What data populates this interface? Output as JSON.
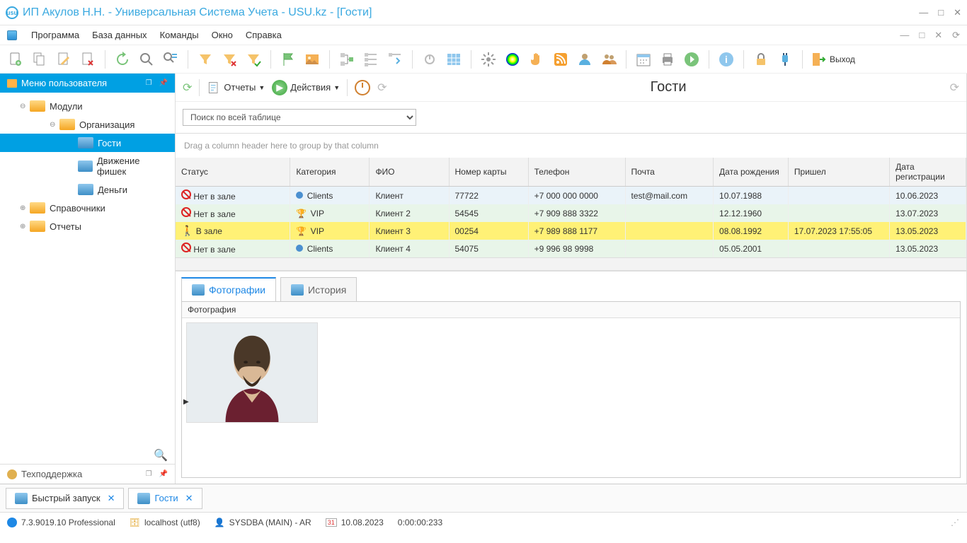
{
  "title": "ИП Акулов Н.Н. - Универсальная Система Учета - USU.kz - [Гости]",
  "menubar": {
    "items": [
      "Программа",
      "База данных",
      "Команды",
      "Окно",
      "Справка"
    ]
  },
  "toolbar": {
    "exit": "Выход"
  },
  "sidebar": {
    "title": "Меню пользователя",
    "modules": "Модули",
    "organization": "Организация",
    "guests": "Гости",
    "chips": "Движение фишек",
    "money": "Деньги",
    "refs": "Справочники",
    "reports": "Отчеты",
    "support": "Техподдержка"
  },
  "subtoolbar": {
    "reports": "Отчеты",
    "actions": "Действия",
    "title": "Гости"
  },
  "search": {
    "placeholder": "Поиск по всей таблице"
  },
  "grid": {
    "groupHint": "Drag a column header here to group by that column",
    "headers": [
      "Статус",
      "Категория",
      "ФИО",
      "Номер карты",
      "Телефон",
      "Почта",
      "Дата рождения",
      "Пришел",
      "Дата регистрации"
    ],
    "rows": [
      {
        "statusIcon": "out",
        "status": "Нет в зале",
        "catIcon": "client",
        "cat": "Clients",
        "fio": "Клиент",
        "card": "77722",
        "tel": "+7 000 000 0000",
        "mail": "test@mail.com",
        "dob": "10.07.1988",
        "came": "",
        "reg": "10.06.2023"
      },
      {
        "statusIcon": "out",
        "status": "Нет в зале",
        "catIcon": "vip",
        "cat": "VIP",
        "fio": "Клиент 2",
        "card": "54545",
        "tel": "+7 909 888 3322",
        "mail": "",
        "dob": "12.12.1960",
        "came": "",
        "reg": "13.07.2023"
      },
      {
        "statusIcon": "in",
        "status": "В зале",
        "catIcon": "vip",
        "cat": "VIP",
        "fio": "Клиент 3",
        "card": "00254",
        "tel": "+7 989 888 1177",
        "mail": "",
        "dob": "08.08.1992",
        "came": "17.07.2023 17:55:05",
        "reg": "13.05.2023"
      },
      {
        "statusIcon": "out",
        "status": "Нет в зале",
        "catIcon": "client",
        "cat": "Clients",
        "fio": "Клиент 4",
        "card": "54075",
        "tel": "+9 996 98 9998",
        "mail": "",
        "dob": "05.05.2001",
        "came": "",
        "reg": "13.05.2023"
      }
    ]
  },
  "tabs": {
    "photos": "Фотографии",
    "history": "История",
    "photoHeader": "Фотография"
  },
  "bottomTabs": {
    "quick": "Быстрый запуск",
    "guests": "Гости"
  },
  "statusbar": {
    "version": "7.3.9019.10 Professional",
    "host": "localhost (utf8)",
    "user": "SYSDBA (MAIN) - AR",
    "calnum": "31",
    "date": "10.08.2023",
    "time": "0:00:00:233"
  }
}
